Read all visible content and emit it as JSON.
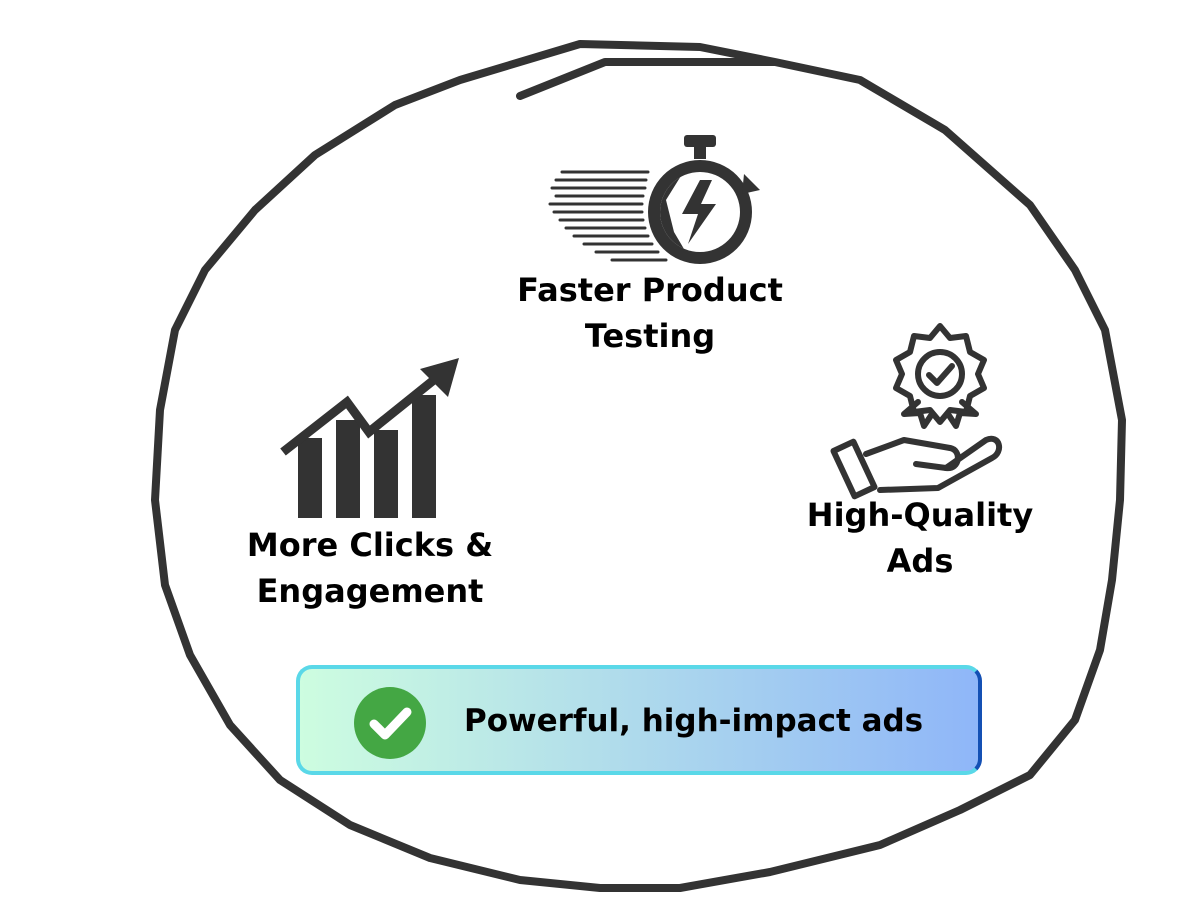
{
  "items": [
    {
      "id": "testing",
      "icon": "stopwatch-lightning-icon",
      "lines": [
        "Faster Product",
        "Testing"
      ]
    },
    {
      "id": "quality",
      "icon": "hand-award-icon",
      "lines": [
        "High-Quality",
        "Ads"
      ]
    },
    {
      "id": "clicks",
      "icon": "growth-chart-icon",
      "lines": [
        "More Clicks &",
        "Engagement"
      ]
    }
  ],
  "banner": {
    "text": "Powerful, high-impact ads",
    "icon": "check-circle-icon"
  },
  "colors": {
    "stroke": "#333333",
    "check_green": "#44a744",
    "banner_gradient_start": "#cdfde0",
    "banner_gradient_end": "#8fb6f8",
    "banner_border_start": "#5ad8e8",
    "banner_border_end": "#1450b4"
  }
}
